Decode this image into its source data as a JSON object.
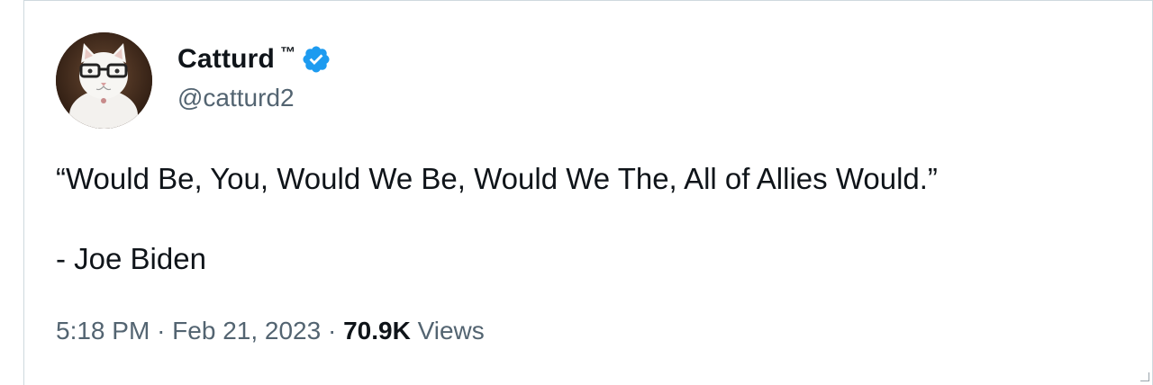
{
  "author": {
    "display_name": "Catturd",
    "trademark": "™",
    "handle": "@catturd2",
    "verified": true,
    "avatar_icon": "cat-with-glasses-avatar"
  },
  "tweet": {
    "text": "“Would Be, You, Would We Be, Would We The, All of Allies Would.”",
    "attribution": "- Joe Biden"
  },
  "meta": {
    "time": "5:18 PM",
    "separator": "·",
    "date": "Feb 21, 2023",
    "views_count": "70.9K",
    "views_label": "Views"
  },
  "colors": {
    "text": "#0f1419",
    "secondary": "#536471",
    "verified": "#1d9bf0",
    "border": "#cfd9de"
  }
}
